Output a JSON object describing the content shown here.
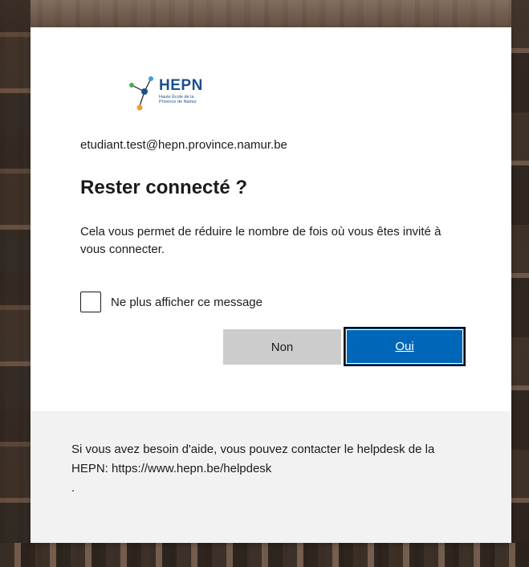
{
  "brand": {
    "name": "HEPN",
    "subtitle": "Haute École de la Province de Namur"
  },
  "account": {
    "email": "etudiant.test@hepn.province.namur.be"
  },
  "dialog": {
    "title": "Rester connecté ?",
    "description": "Cela vous permet de réduire le nombre de fois où vous êtes invité à vous connecter.",
    "checkbox_label": "Ne plus afficher ce message",
    "checkbox_checked": false,
    "no_button": "Non",
    "yes_button": "Oui"
  },
  "footer": {
    "help_text": "Si vous avez besoin d'aide, vous pouvez contacter le helpdesk de la HEPN: https://www.hepn.be/helpdesk",
    "help_suffix": "."
  },
  "colors": {
    "primary": "#0067b8",
    "brand_blue": "#1b4f8f",
    "footer_bg": "#f2f2f2",
    "secondary_button": "#cccccc"
  },
  "icons": {
    "logo": "hepn-molecule-logo"
  }
}
